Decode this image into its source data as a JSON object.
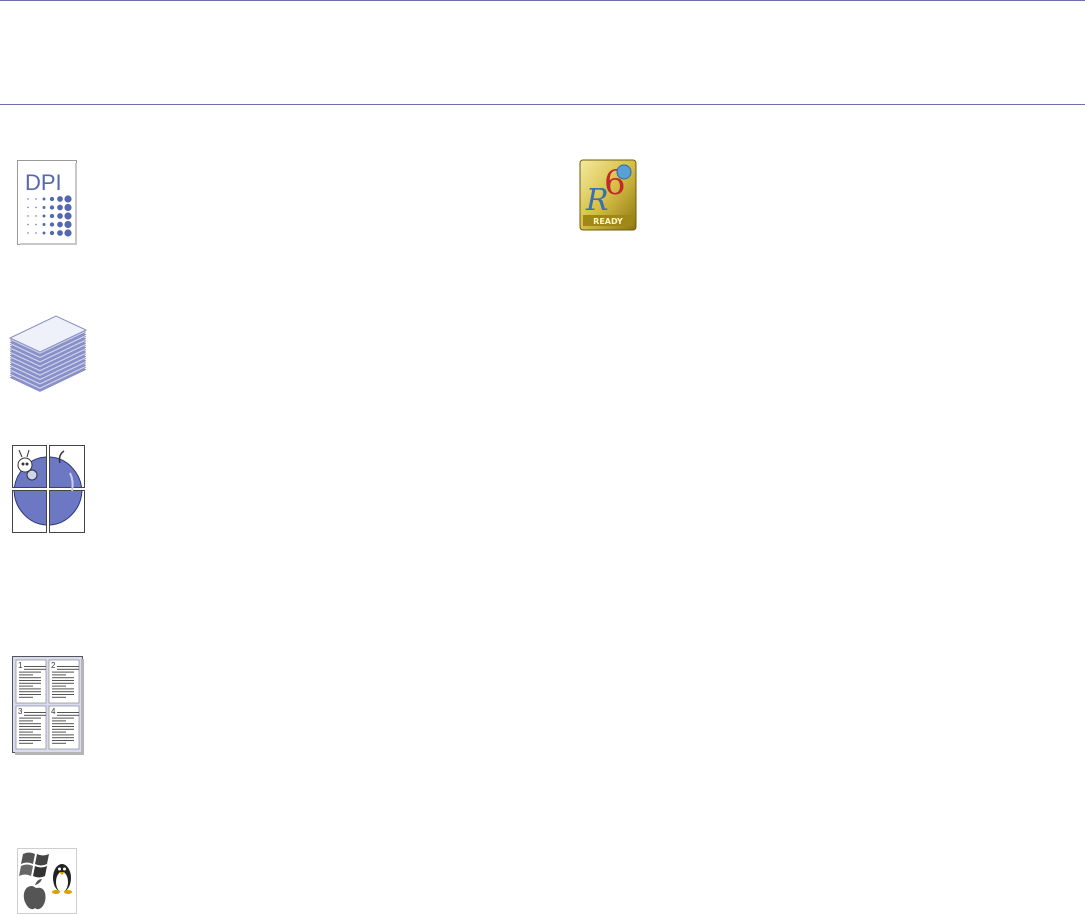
{
  "page": {
    "header_text": "",
    "body_text": ""
  },
  "features": [
    {
      "icon": "dpi-icon",
      "label": "DPI"
    },
    {
      "icon": "ipv6-ready-icon",
      "label": "READY"
    },
    {
      "icon": "paper-stack-icon"
    },
    {
      "icon": "poster-apple-icon"
    },
    {
      "icon": "n-up-pages-icon",
      "page_numbers": [
        "1",
        "2",
        "3",
        "4"
      ]
    },
    {
      "icon": "os-support-icon"
    }
  ],
  "colors": {
    "rule": "#6e72a8",
    "accent_blue": "#5468b0",
    "poster_fill": "#6c78c4",
    "page_shade": "#d9dcf0",
    "ipv6_gold": "#b39b1c"
  }
}
